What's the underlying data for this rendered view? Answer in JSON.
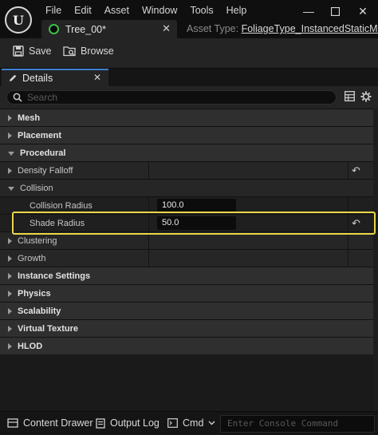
{
  "menu": [
    "File",
    "Edit",
    "Asset",
    "Window",
    "Tools",
    "Help"
  ],
  "tab": {
    "label": "Tree_00*"
  },
  "asset_type": {
    "label": "Asset Type:",
    "value": "FoliageType_InstancedStaticMesh"
  },
  "toolbar": {
    "save_label": "Save",
    "browse_label": "Browse"
  },
  "details_tab": {
    "label": "Details"
  },
  "search": {
    "placeholder": "Search"
  },
  "rows": {
    "mesh": "Mesh",
    "placement": "Placement",
    "procedural": "Procedural",
    "density_falloff": "Density Falloff",
    "collision": "Collision",
    "collision_radius": {
      "label": "Collision Radius",
      "value": "100.0"
    },
    "shade_radius": {
      "label": "Shade Radius",
      "value": "50.0"
    },
    "clustering": "Clustering",
    "growth": "Growth",
    "instance_settings": "Instance Settings",
    "physics": "Physics",
    "scalability": "Scalability",
    "virtual_texture": "Virtual Texture",
    "hlod": "HLOD"
  },
  "bottombar": {
    "content_drawer": "Content Drawer",
    "output_log": "Output Log",
    "cmd": "Cmd",
    "console_placeholder": "Enter Console Command"
  },
  "icons": {
    "logo": "unreal-logo-icon",
    "tab": "foliage-type-icon",
    "save": "save-icon",
    "browse": "browse-icon",
    "details": "pencil-icon",
    "search": "search-icon",
    "grid": "grid-view-icon",
    "settings": "gear-icon",
    "reset": "reset-to-default-icon"
  },
  "colors": {
    "highlight": "#e8d64a",
    "tab_accent": "#3d7fd0",
    "foliage_icon": "#3bbf4a"
  }
}
